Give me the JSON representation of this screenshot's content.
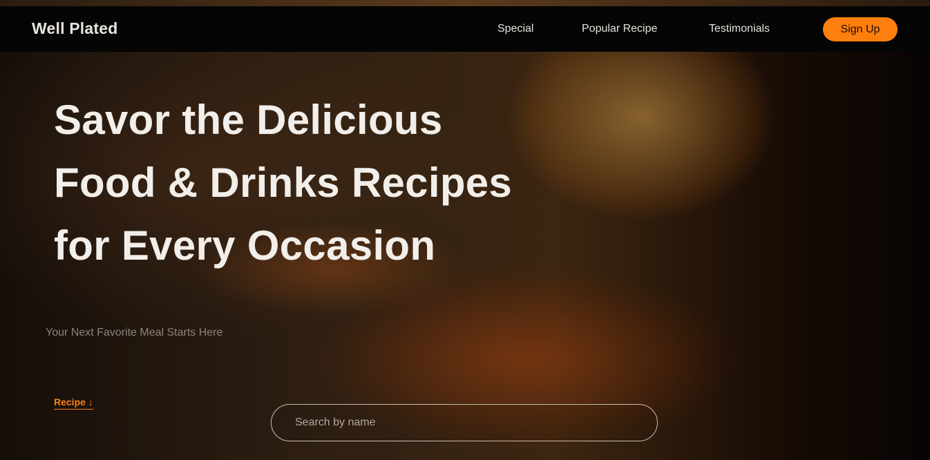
{
  "header": {
    "brand": "Well Plated",
    "nav": [
      "Special",
      "Popular Recipe",
      "Testimonials"
    ],
    "signup_label": "Sign Up"
  },
  "hero": {
    "headline_lines": [
      "Savor the Delicious",
      "Food & Drinks Recipes",
      "for Every Occasion"
    ],
    "subtitle": "Your Next Favorite Meal Starts Here",
    "recipe_link": "Recipe ↓"
  },
  "search": {
    "placeholder": "Search by name"
  },
  "colors": {
    "accent": "#ff7f0e",
    "navbar": "#050505"
  }
}
